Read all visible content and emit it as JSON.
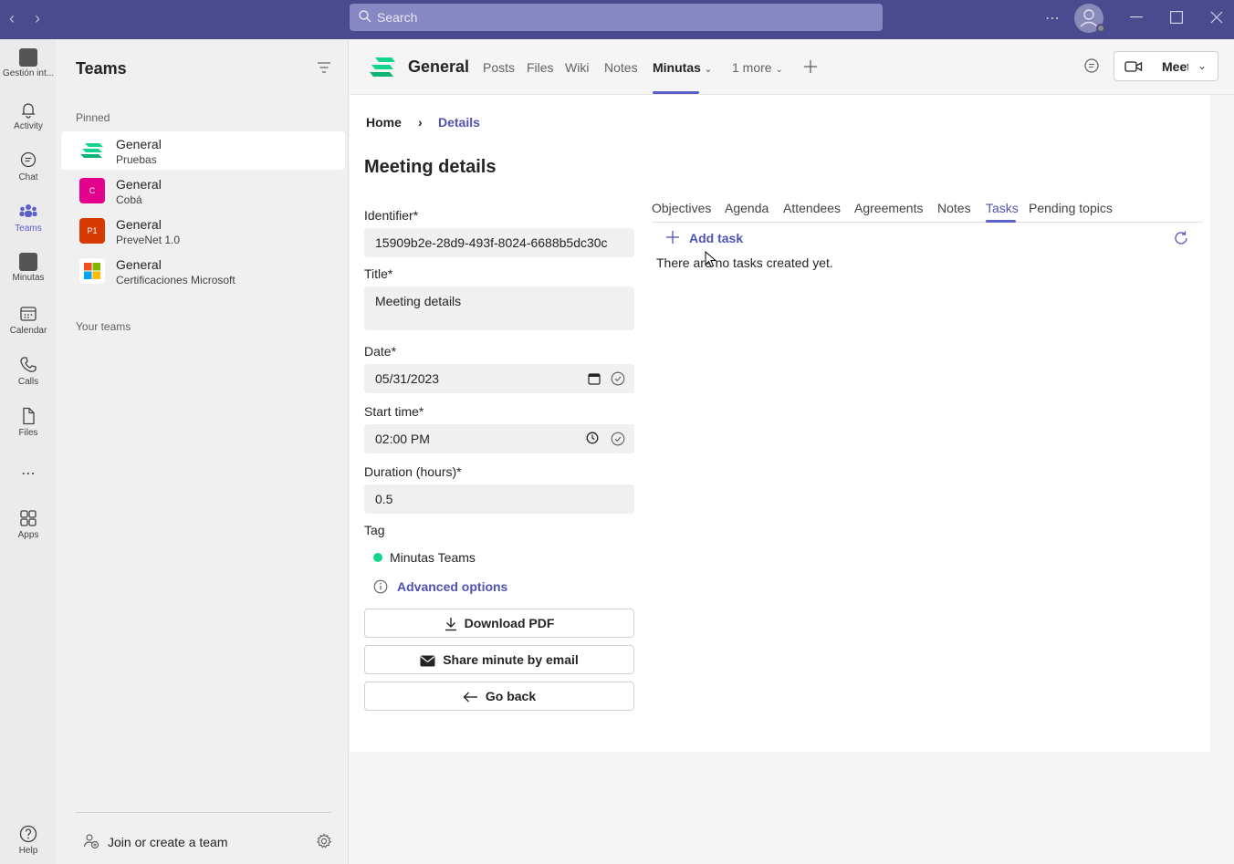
{
  "titlebar": {
    "search_placeholder": "Search"
  },
  "rail": {
    "items": [
      {
        "label": "Gestión int...",
        "icon": "app-square-icon"
      },
      {
        "label": "Activity",
        "icon": "bell-icon"
      },
      {
        "label": "Chat",
        "icon": "chat-icon"
      },
      {
        "label": "Teams",
        "icon": "teams-icon"
      },
      {
        "label": "Minutas",
        "icon": "app-square-icon"
      },
      {
        "label": "Calendar",
        "icon": "calendar-icon"
      },
      {
        "label": "Calls",
        "icon": "phone-icon"
      },
      {
        "label": "Files",
        "icon": "file-icon"
      },
      {
        "label": "Apps",
        "icon": "apps-icon"
      },
      {
        "label": "Help",
        "icon": "help-icon"
      }
    ]
  },
  "teams_panel": {
    "title": "Teams",
    "pinned_label": "Pinned",
    "your_teams_label": "Your teams",
    "teams": [
      {
        "name": "General",
        "sub": "Pruebas",
        "logo_text": "",
        "color": "#13d48b"
      },
      {
        "name": "General",
        "sub": "Cobá",
        "logo_text": "C",
        "color": "#e3008c"
      },
      {
        "name": "General",
        "sub": "PreveNet 1.0",
        "logo_text": "P1",
        "color": "#d83b01"
      },
      {
        "name": "General",
        "sub": "Certificaciones Microsoft",
        "logo_text": "",
        "color": "#ffffff"
      }
    ],
    "join_label": "Join or create a team"
  },
  "header": {
    "channel_name": "General",
    "tabs": [
      {
        "label": "Posts"
      },
      {
        "label": "Files"
      },
      {
        "label": "Wiki"
      },
      {
        "label": "Notes"
      },
      {
        "label": "Minutas"
      },
      {
        "label": "1 more"
      }
    ],
    "meet_label": "Meet"
  },
  "content": {
    "breadcrumb": {
      "home": "Home",
      "current": "Details"
    },
    "page_title": "Meeting details",
    "form": {
      "identifier_label": "Identifier*",
      "identifier_value": "15909b2e-28d9-493f-8024-6688b5dc30c",
      "title_label": "Title*",
      "title_value": "Meeting details",
      "date_label": "Date*",
      "date_value": "05/31/2023",
      "start_label": "Start time*",
      "start_value": "02:00 PM",
      "duration_label": "Duration (hours)*",
      "duration_value": "0.5",
      "tag_label": "Tag",
      "tag_value": "Minutas Teams",
      "tag_color": "#13d48b",
      "advanced_label": "Advanced options"
    },
    "actions": {
      "download": "Download PDF",
      "share": "Share minute by email",
      "back": "Go back"
    },
    "detail_tabs": [
      {
        "label": "Objectives"
      },
      {
        "label": "Agenda"
      },
      {
        "label": "Attendees"
      },
      {
        "label": "Agreements"
      },
      {
        "label": "Notes"
      },
      {
        "label": "Tasks"
      },
      {
        "label": "Pending topics"
      }
    ],
    "add_task": "Add task",
    "empty_message": "There are no tasks created yet."
  },
  "colors": {
    "titlebar": "#4a4a8f",
    "accent": "#5b5fc7",
    "link": "#4f52b2"
  }
}
